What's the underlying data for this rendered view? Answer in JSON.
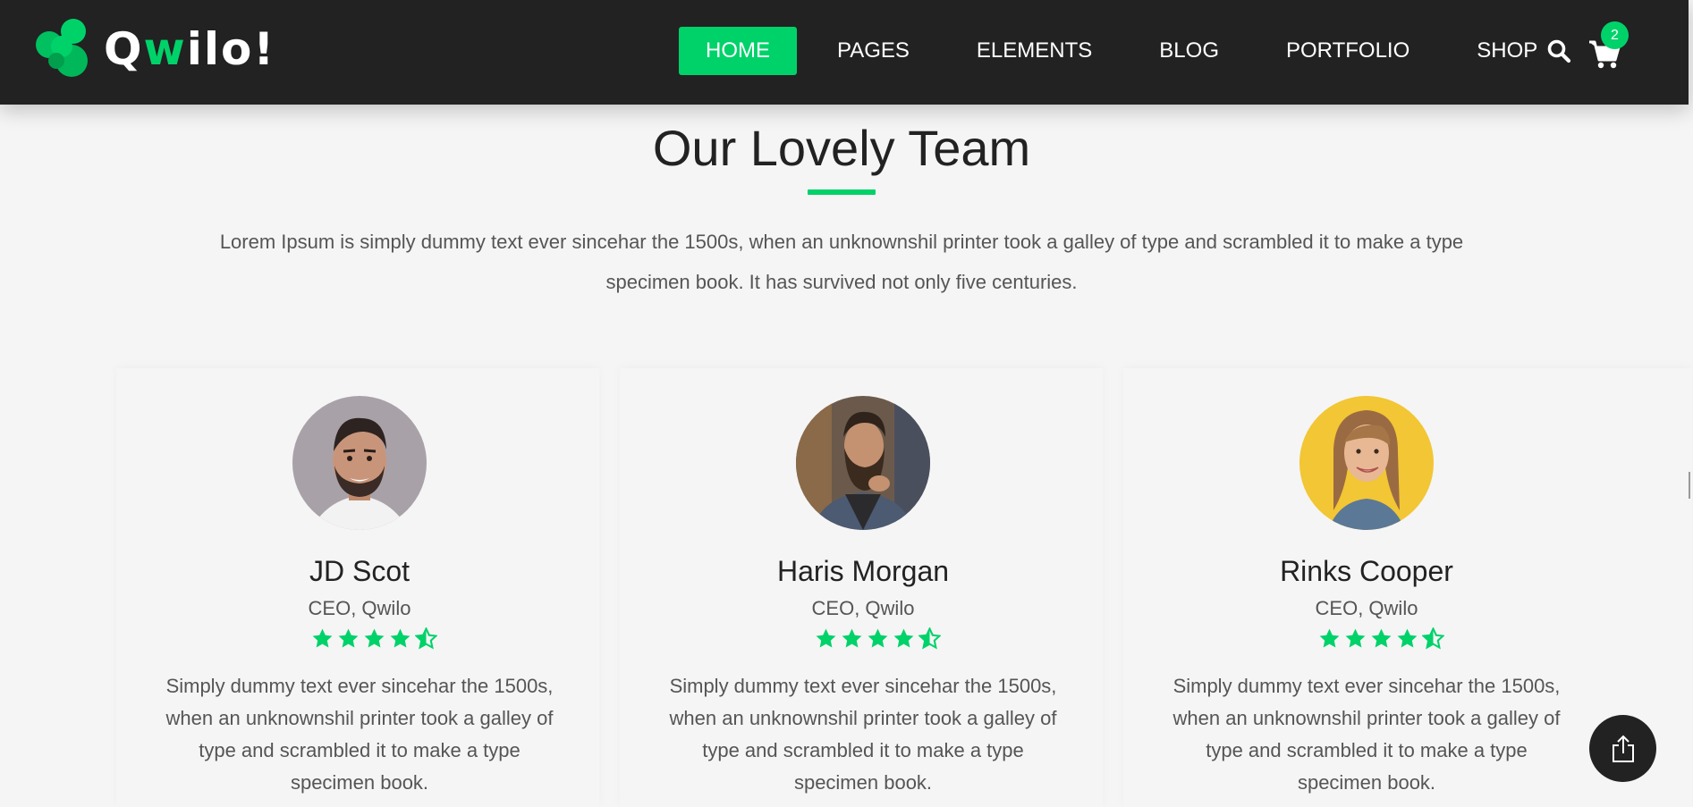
{
  "brand": {
    "logo_prefix": "Q",
    "logo_accent": "w",
    "logo_suffix": "ilo!",
    "accent_color": "#00d26a",
    "header_bg": "#222222"
  },
  "nav": {
    "items": [
      {
        "label": "HOME",
        "active": true
      },
      {
        "label": "PAGES",
        "active": false
      },
      {
        "label": "ELEMENTS",
        "active": false
      },
      {
        "label": "BLOG",
        "active": false
      },
      {
        "label": "PORTFOLIO",
        "active": false
      },
      {
        "label": "SHOP",
        "active": false
      }
    ],
    "search_icon": "search-icon",
    "cart_icon": "cart-icon",
    "cart_count": "2"
  },
  "section": {
    "title": "Our Lovely Team",
    "intro": "Lorem Ipsum is simply dummy text ever sincehar the 1500s, when an unknownshil printer took a galley of type and scrambled it to make a type specimen book. It has survived not only five centuries."
  },
  "team": [
    {
      "name": "JD Scot",
      "role": "CEO, Qwilo",
      "rating": 4.5,
      "bio": "Simply dummy text ever sincehar the 1500s, when an unknownshil printer took a galley of type and scrambled it to make a type specimen book."
    },
    {
      "name": "Haris Morgan",
      "role": "CEO, Qwilo",
      "rating": 4.5,
      "bio": "Simply dummy text ever sincehar the 1500s, when an unknownshil printer took a galley of type and scrambled it to make a type specimen book."
    },
    {
      "name": "Rinks Cooper",
      "role": "CEO, Qwilo",
      "rating": 4.5,
      "bio": "Simply dummy text ever sincehar the 1500s, when an unknownshil printer took a galley of type and scrambled it to make a type specimen book."
    }
  ],
  "share": {
    "icon": "share-icon"
  }
}
